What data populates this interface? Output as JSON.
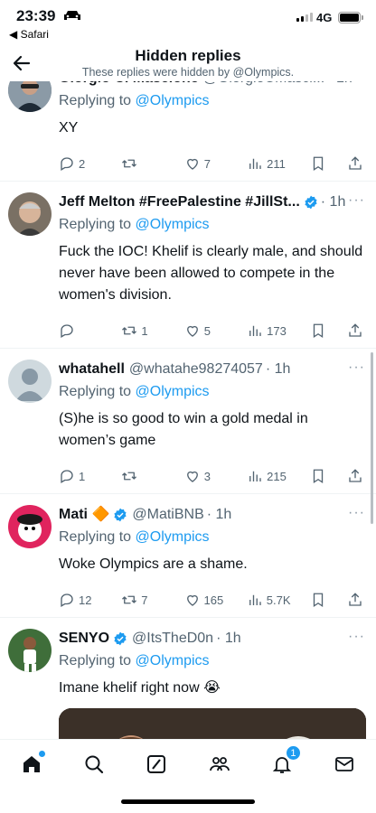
{
  "status_bar": {
    "time": "23:39",
    "back_app": "◀ Safari",
    "network": "4G"
  },
  "header": {
    "title": "Hidden replies",
    "subtitle": "These replies were hidden by @Olympics."
  },
  "tweets": [
    {
      "name": "Giorgio C. Mascione",
      "handle": "@GiorgioCMascl...",
      "time": "· 1h",
      "verified": false,
      "replying_prefix": "Replying to ",
      "replying_to": "@Olympics",
      "text": "XY",
      "replies": "2",
      "retweets": "",
      "likes": "7",
      "views": "211"
    },
    {
      "name": "Jeff Melton #FreePalestine #JillSt...",
      "handle": "",
      "time": "· 1h",
      "verified": true,
      "replying_prefix": "Replying to ",
      "replying_to": "@Olympics",
      "text": "Fuck the IOC! Khelif is clearly male, and should never have been allowed to compete in the women's division.",
      "replies": "",
      "retweets": "1",
      "likes": "5",
      "views": "173"
    },
    {
      "name": "whatahell",
      "handle": "@whatahe98274057",
      "time": "· 1h",
      "verified": false,
      "replying_prefix": "Replying to ",
      "replying_to": "@Olympics",
      "text": "(S)he is so good to win a gold medal in women’s game",
      "replies": "1",
      "retweets": "",
      "likes": "3",
      "views": "215"
    },
    {
      "name": "Mati 🔶",
      "handle": "@MatiBNB",
      "time": "· 1h",
      "verified": true,
      "replying_prefix": "Replying to ",
      "replying_to": "@Olympics",
      "text": "Woke Olympics are a shame.",
      "replies": "12",
      "retweets": "7",
      "likes": "165",
      "views": "5.7K"
    },
    {
      "name": "SENYO",
      "handle": "@ItsTheD0n",
      "time": "· 1h",
      "verified": true,
      "replying_prefix": "Replying to ",
      "replying_to": "@Olympics",
      "text": "Imane khelif right now 😭"
    }
  ],
  "bottom_nav": {
    "notifications_badge": "1"
  },
  "colors": {
    "accent": "#1d9bf0",
    "secondary_text": "#536471"
  }
}
